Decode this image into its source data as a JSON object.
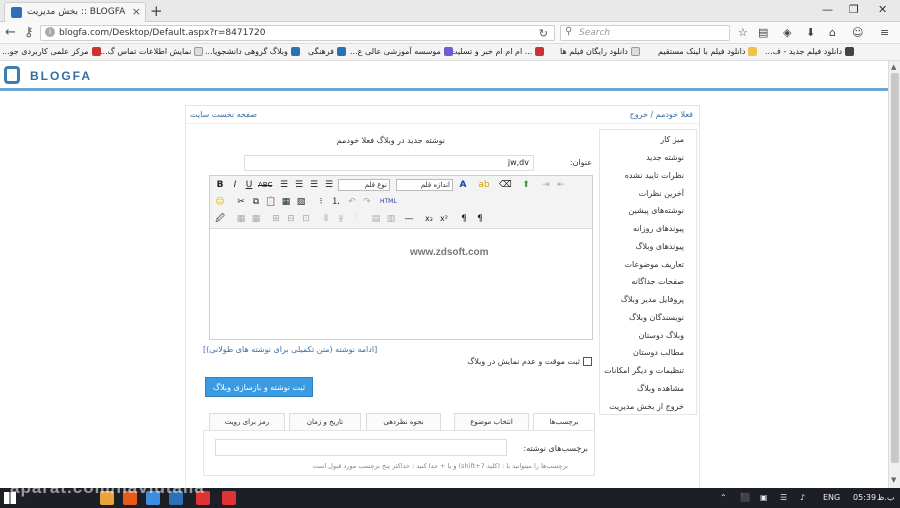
{
  "browser": {
    "tab_title": "بخش مدیریت :: BLOGFA",
    "url": "blogfa.com/Desktop/Default.aspx?r=8471720",
    "search_placeholder": "Search",
    "bookmarks": [
      "دانلود فیلم جدید - ف...",
      "دانلود فیلم با لینک مستقیم",
      "دانلود رایگان فیلم ها",
      "... ام ام ام خبر و تسلیت",
      "موسسه آموزشی عالی ع...",
      "فرهنگی",
      "وبلاگ گروهی دانشجویا...",
      "نمایش اطلاعات تماس گ...",
      "مرکز علمی کاربردی جو..."
    ]
  },
  "site": {
    "logo": "BLOGFA"
  },
  "topbar": {
    "breadcrumb": "فعلا خودمم / خروج",
    "home_link": "صفحه نخست سایت"
  },
  "sidebar": {
    "items": [
      "میز کار",
      "نوشته جدید",
      "نظرات تایید نشده",
      "آخرین نظرات",
      "نوشته‌های پیشین",
      "پیوندهای روزانه",
      "پیوندهای وبلاگ",
      "تعاریف موضوعات",
      "صفحات جداگانه",
      "پروفایل مدیر وبلاگ",
      "نویسندگان وبلاگ",
      "وبلاگ دوستان",
      "مطالب دوستان",
      "تنظیمات و دیگر امکانات",
      "مشاهده وبلاگ",
      "خروج از بخش مدیریت"
    ]
  },
  "editor": {
    "heading": "نوشته جدید در وبلاگ فعلا خودمم",
    "title_label": "عنوان:",
    "title_value": "jw,dv",
    "font_family_label": "نوع قلم",
    "font_size_label": "اندازه قلم",
    "watermark": "www.zdsoft.com",
    "more_link": "[ادامه نوشته (متن تکمیلی برای نوشته های طولانی)]",
    "temp_hide_label": "ثبت موقت و عدم نمایش در وبلاگ",
    "save_button": "ثبت نوشته و بازسازی وبلاگ",
    "tabs": [
      "برچسب‌ها",
      "انتخاب موضوع",
      "نحوه نظردهی",
      "تاریخ و زمان",
      "رمز برای رویت"
    ],
    "tags_label": "برچسب‌های نوشته:",
    "tags_help": "برچسب‌ها را میتوانید با : (کلید shift+7) و یا + جدا کنید : حداکثر پنج برچسب مورد قبول است"
  },
  "taskbar": {
    "time": "05:39",
    "ampm": "ب.ظ",
    "lang": "ENG"
  },
  "overlay": {
    "watermark": "aparat.com/navidtalia"
  }
}
